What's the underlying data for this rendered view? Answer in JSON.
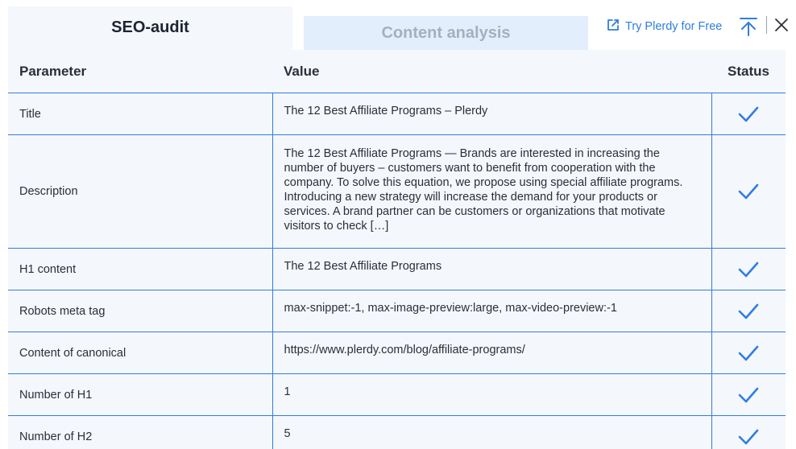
{
  "tabs": {
    "seo_audit": "SEO-audit",
    "content_analysis": "Content analysis"
  },
  "header": {
    "try_label": "Try Plerdy for Free",
    "try_icon": "external-link-icon",
    "pin_icon": "pin-top-icon",
    "close_icon": "close-icon"
  },
  "colors": {
    "accent": "#2f7de1",
    "table_bg": "#f4f7fc",
    "inactive_tab_bg": "#e3eefc",
    "inactive_tab_text": "#a6b0bd"
  },
  "table": {
    "columns": [
      "Parameter",
      "Value",
      "Status"
    ],
    "rows": [
      {
        "parameter": "Title",
        "value": "The 12 Best Affiliate Programs – Plerdy",
        "status": "check-icon"
      },
      {
        "parameter": "Description",
        "value": "The 12 Best Affiliate Programs — Brands are interested in increasing the number of buyers – customers want to benefit from cooperation with the company. To solve this equation, we propose using special affiliate programs. Introducing a new strategy will increase the demand for your products or services. A brand partner can be customers or organizations that motivate visitors to check […]",
        "status": "check-icon"
      },
      {
        "parameter": "H1 content",
        "value": "The 12 Best Affiliate Programs",
        "status": "check-icon"
      },
      {
        "parameter": "Robots meta tag",
        "value": "max-snippet:-1, max-image-preview:large, max-video-preview:-1",
        "status": "check-icon"
      },
      {
        "parameter": "Content of canonical",
        "value": "https://www.plerdy.com/blog/affiliate-programs/",
        "status": "check-icon"
      },
      {
        "parameter": "Number of H1",
        "value": "1",
        "status": "check-icon"
      },
      {
        "parameter": "Number of H2",
        "value": "5",
        "status": "check-icon"
      }
    ]
  }
}
